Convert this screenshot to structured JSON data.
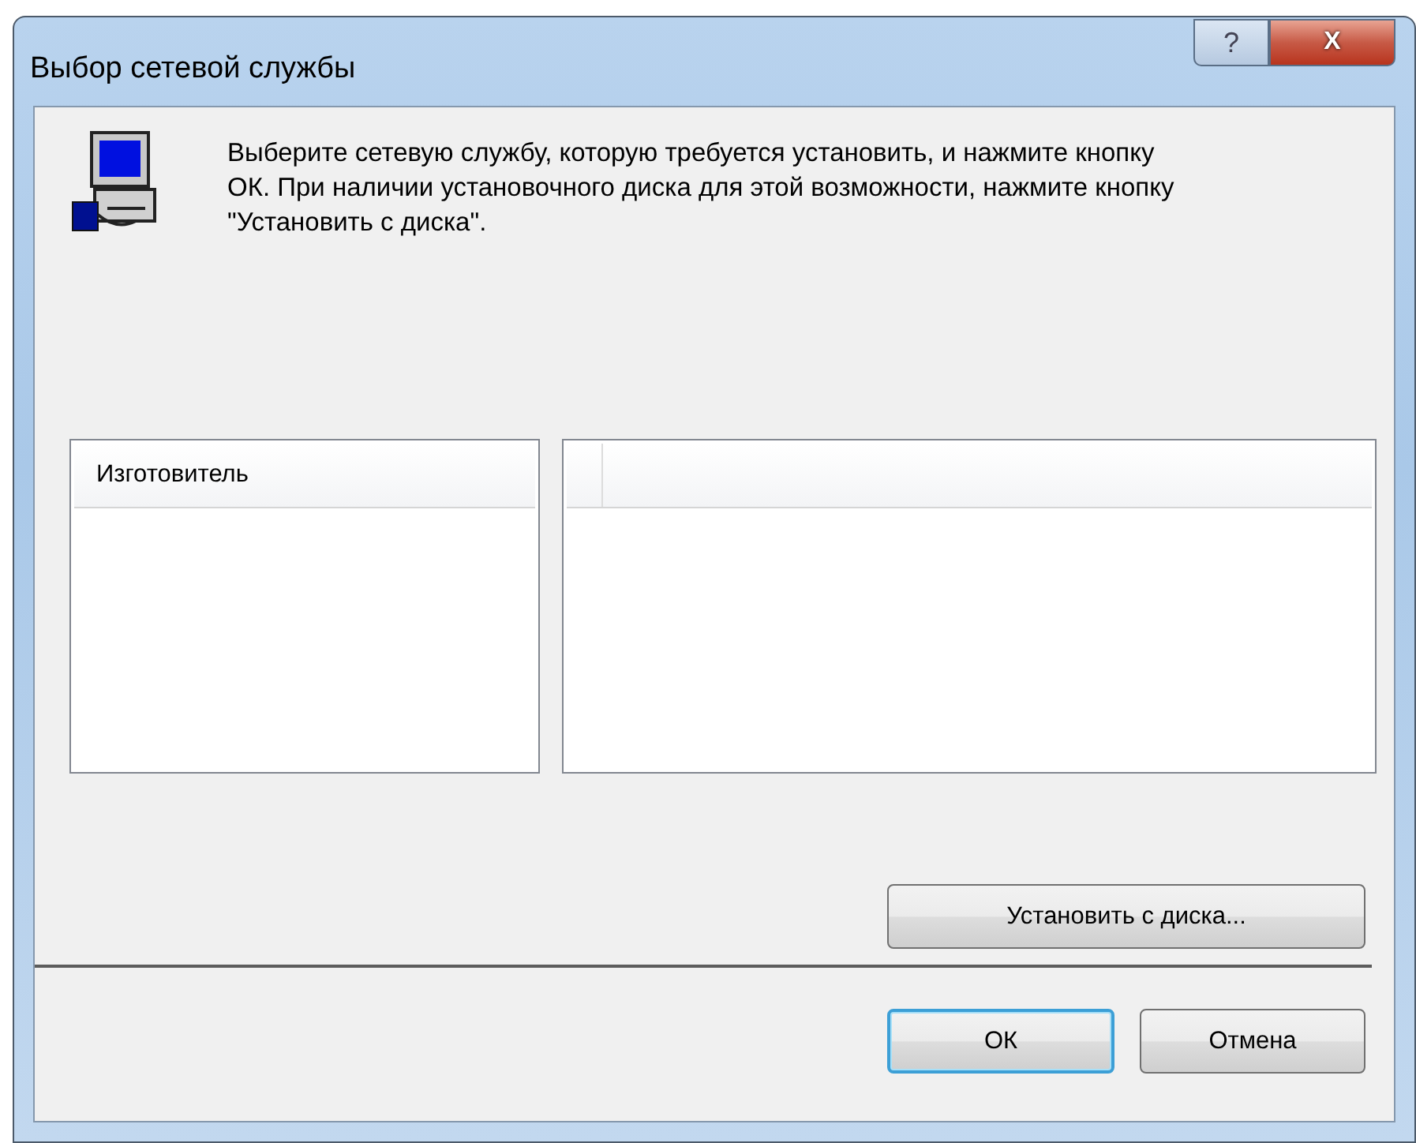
{
  "window": {
    "title": "Выбор сетевой службы",
    "title_buttons": [
      "?",
      "X"
    ]
  },
  "instruction": "Выберите сетевую службу, которую требуется установить, и нажмите кнопку ОК. При наличии установочного диска для этой возможности, нажмите кнопку \"Установить с диска\".",
  "manufacturer_list": {
    "header": "Изготовитель"
  },
  "install_button": {
    "label": "Установить с диска..."
  },
  "buttons": [
    {
      "label": "ОК",
      "default": true
    },
    {
      "label": "Отмена",
      "default": false
    }
  ]
}
